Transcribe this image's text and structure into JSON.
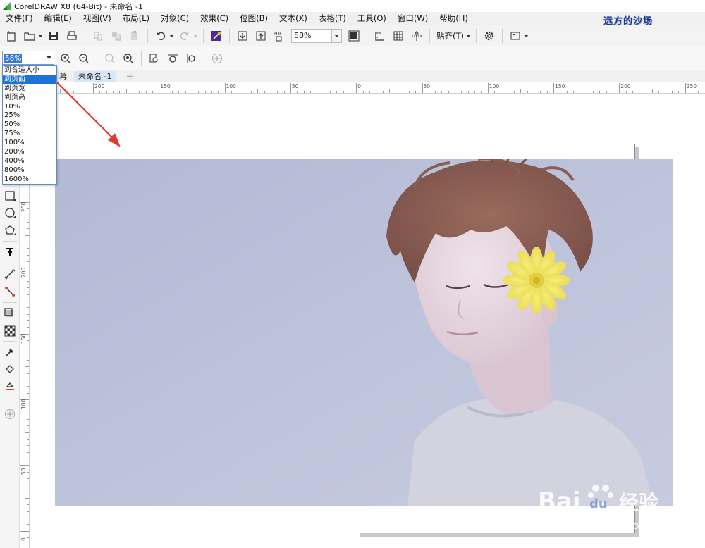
{
  "window": {
    "title": "CorelDRAW X8 (64-Bit) - 未命名 -1",
    "brand_color": "#3ab54a"
  },
  "menubar": {
    "items": [
      "文件(F)",
      "编辑(E)",
      "视图(V)",
      "布局(L)",
      "对象(C)",
      "效果(C)",
      "位图(B)",
      "文本(X)",
      "表格(T)",
      "工具(O)",
      "窗口(W)",
      "帮助(H)"
    ],
    "corner_watermark": "远方的沙场"
  },
  "toolbar": {
    "zoom_value": "58%",
    "pdf_label": "PDF",
    "snap_label": "贴齐(T)"
  },
  "toolbar2": {
    "zoom_value": "58%"
  },
  "zoom_dropdown": {
    "items": [
      "到合适大小",
      "到页面",
      "到页宽",
      "到页高",
      "10%",
      "25%",
      "50%",
      "75%",
      "100%",
      "200%",
      "400%",
      "800%",
      "1600%"
    ],
    "selected_index": 1
  },
  "tabs": {
    "items": [
      "欢迎屏幕",
      "未命名 -1"
    ],
    "visible_first_fragment": "幕",
    "active_index": 1
  },
  "ruler": {
    "h_labels": [
      "200",
      "150",
      "100",
      "50",
      "0",
      "50",
      "100",
      "150",
      "200",
      "250"
    ],
    "v_labels": [
      "250",
      "200",
      "150",
      "100",
      "50",
      "0"
    ]
  },
  "watermark": {
    "baidu": "Bai",
    "baidu_du": "du",
    "jingyan": "经验",
    "url": "jingyan.baidu.com"
  },
  "annotation_color": "#e23a2e"
}
